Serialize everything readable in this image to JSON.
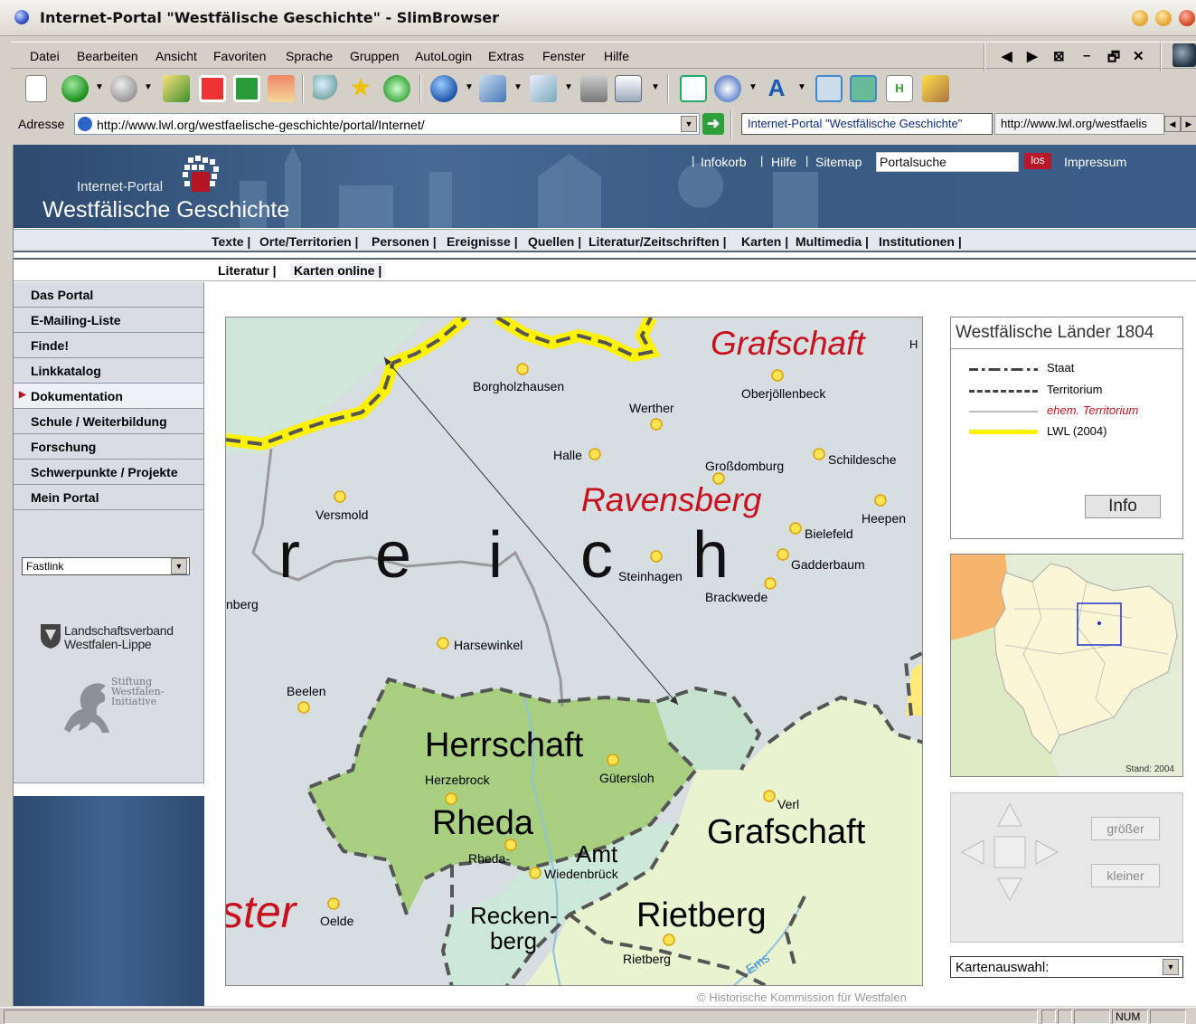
{
  "window": {
    "title": "Internet-Portal \"Westfälische Geschichte\" - SlimBrowser"
  },
  "menu": [
    "Datei",
    "Bearbeiten",
    "Ansicht",
    "Favoriten",
    "Sprache",
    "Gruppen",
    "AutoLogin",
    "Extras",
    "Fenster",
    "Hilfe"
  ],
  "address": {
    "label": "Adresse",
    "url": "http://www.lwl.org/westfaelische-geschichte/portal/Internet/",
    "tab1": "Internet-Portal \"Westfälische Geschichte\"",
    "tab2": "http://www.lwl.org/westfaelis"
  },
  "site": {
    "brand_small": "Internet-Portal",
    "brand_big": "Westfälische Geschichte",
    "topnav": [
      "Infokorb",
      "Hilfe",
      "Sitemap"
    ],
    "search_value": "Portalsuche",
    "search_button": "los",
    "impressum": "Impressum",
    "mainnav": [
      "Texte |",
      "Orte/Territorien |",
      "Personen |",
      "Ereignisse |",
      "Quellen |",
      "Literatur/Zeitschriften |",
      "Karten |",
      "Multimedia |",
      "Institutionen |"
    ],
    "subnav": [
      "Literatur |",
      "Karten online |"
    ],
    "leftnav": [
      "Das Portal",
      "E-Mailing-Liste",
      "Finde!",
      "Linkkatalog",
      "Dokumentation",
      "Schule / Weiterbildung",
      "Forschung",
      "Schwerpunkte / Projekte",
      "Mein Portal"
    ],
    "active_index": 4,
    "fastlink": "Fastlink",
    "lwl_logo": "Landschaftsverband Westfalen-Lippe",
    "stiftung_logo": "Stiftung Westfalen-Initiative"
  },
  "map": {
    "labels": {
      "grafschaft_top": "Grafschaft",
      "ravensberg": "Ravensberg",
      "reich_r": "r",
      "reich_e": "e",
      "reich_i": "i",
      "reich_c": "c",
      "reich_h": "h",
      "herrschaft": "Herrschaft",
      "rheda": "Rheda",
      "amt": "Amt",
      "grafschaft_bottom": "Grafschaft",
      "recken": "Recken-",
      "berg": "berg",
      "rietberg_big": "Rietberg",
      "ster": "ster",
      "h_edge": "H",
      "ems": "Ems"
    },
    "towns": [
      "Borgholzhausen",
      "Werther",
      "Oberjöllenbeck",
      "Halle",
      "Schildesche",
      "Großdomburg",
      "Versmold",
      "Heepen",
      "Bielefeld",
      "Steinhagen",
      "Gadderbaum",
      "Brackwede",
      "nberg",
      "Harsewinkel",
      "Beelen",
      "Herzebrock",
      "Gütersloh",
      "Verl",
      "Rheda-",
      "Wiedenbrück",
      "Oelde",
      "Rietberg"
    ],
    "copyright": "© Historische Kommission für Westfalen"
  },
  "legend": {
    "title": "Westfälische Länder 1804",
    "items": [
      "Staat",
      "Territorium",
      "ehem. Territorium",
      "LWL (2004)"
    ],
    "info_button": "Info"
  },
  "overview": {
    "stand": "Stand: 2004"
  },
  "controls": {
    "bigger": "größer",
    "smaller": "kleiner"
  },
  "kartenauswahl": "Kartenauswahl:",
  "status": {
    "num": "NUM"
  },
  "colors": {
    "banner": "#3a5c86",
    "red_label": "#c8111e",
    "lwl_yellow": "#fff200"
  }
}
